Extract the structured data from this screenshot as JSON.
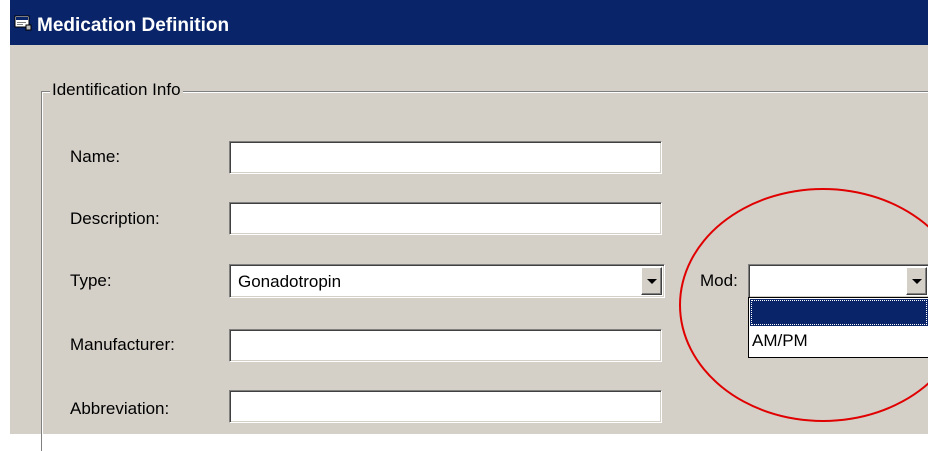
{
  "window": {
    "title": "Medication Definition",
    "icon": "medication-definition-icon"
  },
  "group": {
    "label": "Identification Info"
  },
  "fields": {
    "name": {
      "label": "Name:",
      "value": ""
    },
    "description": {
      "label": "Description:",
      "value": ""
    },
    "type": {
      "label": "Type:",
      "value": "Gonadotropin"
    },
    "manufacturer": {
      "label": "Manufacturer:",
      "value": ""
    },
    "abbreviation": {
      "label": "Abbreviation:",
      "value": ""
    },
    "mod": {
      "label": "Mod:",
      "value": "",
      "options": [
        "",
        "AM/PM"
      ],
      "dropdown_open": true
    }
  },
  "icons": {
    "dropdown_arrow": "chevron-down-icon"
  },
  "colors": {
    "titlebar": "#0a246a",
    "window_face": "#d4d0c8",
    "selection": "#0a246a",
    "annotation_circle": "#e00000"
  }
}
